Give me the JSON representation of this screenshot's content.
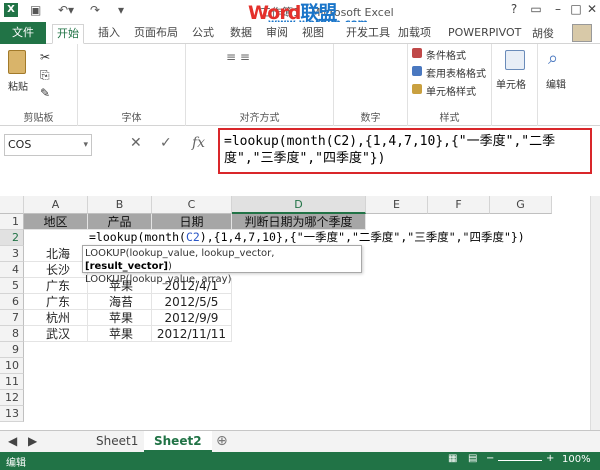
{
  "titlebar": {
    "title": "工作簿1 - Microsoft Excel",
    "watermark_a": "Word",
    "watermark_b": "联盟",
    "watermark_url": "www.wordlm.com"
  },
  "tabs": [
    "文件",
    "开始",
    "插入",
    "页面布局",
    "公式",
    "数据",
    "审阅",
    "视图",
    "开发工具",
    "加载项",
    "POWERPIVOT"
  ],
  "user": "胡俊",
  "ribbon": {
    "paste": "粘贴",
    "clipboard": "剪贴板",
    "font_group": "字体",
    "align_group": "对齐方式",
    "number_group": "数字",
    "style_group": "样式",
    "cond_format": "条件格式",
    "table_format": "套用表格格式",
    "cell_style": "单元格样式",
    "cells": "单元格",
    "edit": "编辑"
  },
  "namebox": "COS",
  "formula": "=lookup(month(C2),{1,4,7,10},{\"一季度\",\"二季度\",\"三季度\",\"四季度\"})",
  "columns": [
    "A",
    "B",
    "C",
    "D",
    "E",
    "F",
    "G"
  ],
  "rows": [
    "1",
    "2",
    "3",
    "4",
    "5",
    "6",
    "7",
    "8",
    "9",
    "10",
    "11",
    "12",
    "13",
    "14"
  ],
  "table": {
    "headers": [
      "地区",
      "产品",
      "日期",
      "判断日期为哪个季度"
    ],
    "data": [
      [
        "北海",
        "",
        "",
        ""
      ],
      [
        "长沙",
        "",
        "",
        ""
      ],
      [
        "广东",
        "苹果",
        "2012/4/1",
        ""
      ],
      [
        "广东",
        "海苔",
        "2012/5/5",
        ""
      ],
      [
        "杭州",
        "苹果",
        "2012/9/9",
        ""
      ],
      [
        "武汉",
        "苹果",
        "2012/11/11",
        ""
      ]
    ]
  },
  "edit": {
    "pre": "=lookup(month(",
    "ref": "C2",
    "post": "),{1,4,7,10},{\"一季度\",\"二季度\",\"三季度\",\"四季度\"})"
  },
  "tooltip": {
    "line1_a": "LOOKUP(lookup_value, lookup_vector, ",
    "line1_b": "[result_vector]",
    "line1_c": ")",
    "line2": "LOOKUP(lookup_value, array)"
  },
  "sheets": [
    "Sheet1",
    "Sheet2"
  ],
  "status": {
    "mode": "编辑",
    "zoom": "100%"
  }
}
